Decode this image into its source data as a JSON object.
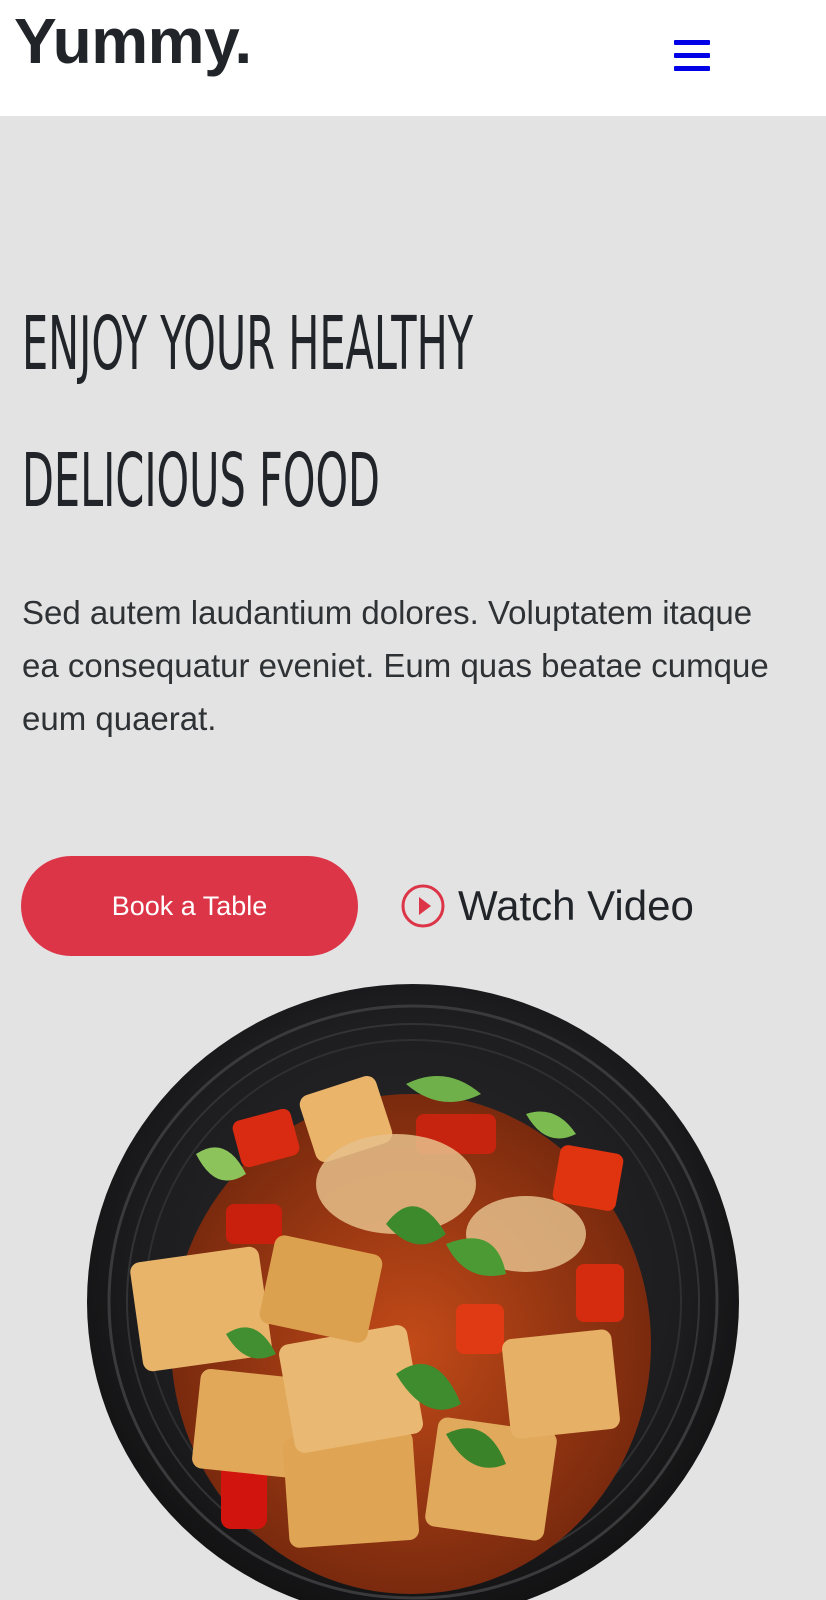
{
  "header": {
    "logo": "Yummy.",
    "menu_icon": "hamburger-menu-icon",
    "menu_color": "#0000e6"
  },
  "hero": {
    "headline_lines": [
      "Enjoy Your Healthy",
      "Delicious Food"
    ],
    "description": "Sed autem laudantium dolores. Voluptatem itaque ea consequatur eveniet. Eum quas beatae cumque eum quaerat.",
    "book_button_label": "Book a Table",
    "watch_video_label": "Watch Video",
    "play_icon": "play-circle-icon",
    "accent_color": "#dd3548",
    "background_color": "#e3e3e4"
  },
  "image": {
    "subject": "hero-food-plate"
  }
}
